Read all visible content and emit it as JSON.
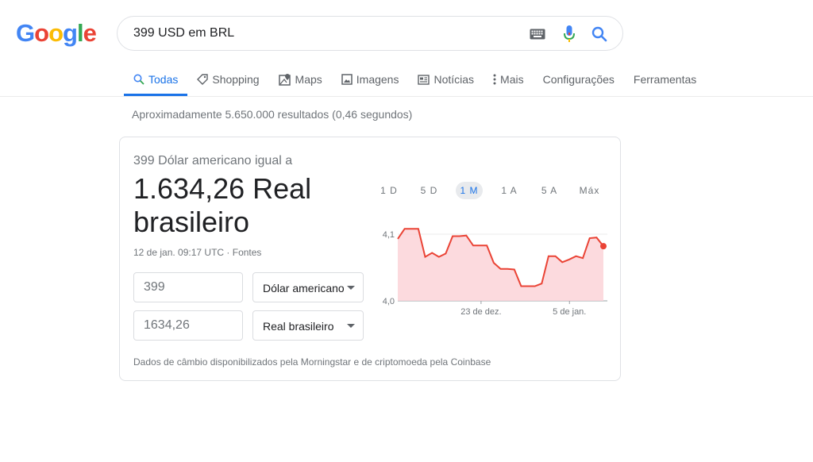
{
  "logo": {
    "letters": [
      {
        "char": "G",
        "color": "#4285f4"
      },
      {
        "char": "o",
        "color": "#ea4335"
      },
      {
        "char": "o",
        "color": "#fbbc05"
      },
      {
        "char": "g",
        "color": "#4285f4"
      },
      {
        "char": "l",
        "color": "#34a853"
      },
      {
        "char": "e",
        "color": "#ea4335"
      }
    ]
  },
  "search": {
    "value": "399 USD em BRL",
    "icons": [
      "keyboard-icon",
      "mic-icon",
      "search-icon"
    ]
  },
  "tabs": [
    {
      "label": "Todas",
      "icon": "search-icon",
      "active": true
    },
    {
      "label": "Shopping",
      "icon": "tag-icon"
    },
    {
      "label": "Maps",
      "icon": "map-icon"
    },
    {
      "label": "Imagens",
      "icon": "image-icon"
    },
    {
      "label": "Notícias",
      "icon": "news-icon"
    },
    {
      "label": "Mais",
      "icon": "more-vert-icon"
    },
    {
      "label": "Configurações"
    },
    {
      "label": "Ferramentas"
    }
  ],
  "stats": "Aproximadamente 5.650.000 resultados (0,46 segundos)",
  "converter": {
    "label": "399 Dólar americano igual a",
    "result": "1.634,26 Real brasileiro",
    "meta": "12 de jan. 09:17 UTC · Fontes",
    "from_value": "399",
    "from_currency": "Dólar americano",
    "to_value": "1634,26",
    "to_currency": "Real brasileiro",
    "source": "Dados de câmbio disponibilizados pela Morningstar e de criptomoeda pela Coinbase",
    "ranges": [
      "1 D",
      "5 D",
      "1 M",
      "1 A",
      "5 A",
      "Máx"
    ],
    "active_range": "1 M"
  },
  "colors": {
    "accent": "#1a73e8",
    "line": "#ea4335",
    "fill": "#fbd3d8"
  },
  "chart_data": {
    "type": "area",
    "y_ticks": [
      "4,1",
      "4,0"
    ],
    "y_tick_values": [
      4.1,
      4.0
    ],
    "x_ticks": [
      {
        "label": "23 de dez.",
        "x": 0.405
      },
      {
        "label": "5 de jan.",
        "x": 0.835
      }
    ],
    "ylim": [
      4.0,
      4.1
    ],
    "series": [
      {
        "values": [
          4.093,
          4.108,
          4.108,
          4.108,
          4.066,
          4.072,
          4.066,
          4.071,
          4.097,
          4.097,
          4.098,
          4.083,
          4.083,
          4.083,
          4.057,
          4.048,
          4.048,
          4.047,
          4.022,
          4.022,
          4.022,
          4.026,
          4.067,
          4.067,
          4.058,
          4.062,
          4.067,
          4.064,
          4.094,
          4.095,
          4.082
        ]
      }
    ]
  }
}
